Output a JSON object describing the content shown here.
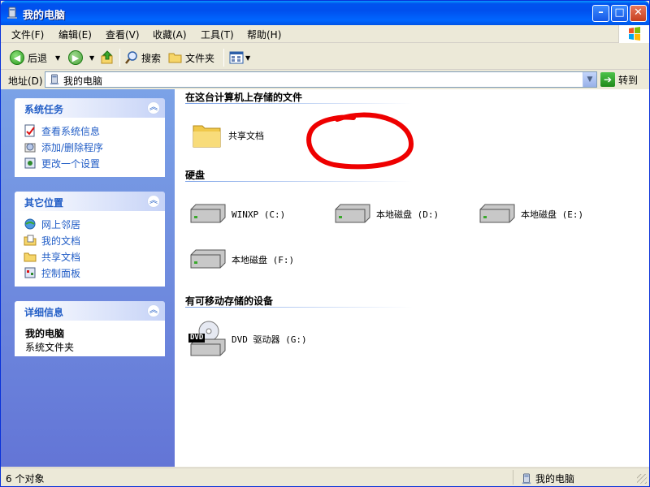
{
  "window": {
    "title": "我的电脑"
  },
  "menu": [
    "文件(F)",
    "编辑(E)",
    "查看(V)",
    "收藏(A)",
    "工具(T)",
    "帮助(H)"
  ],
  "toolbar": {
    "back": "后退",
    "search": "搜索",
    "folders": "文件夹"
  },
  "address": {
    "label": "地址(D)",
    "value": "我的电脑",
    "go": "转到"
  },
  "left_panels": [
    {
      "title": "系统任务",
      "items": [
        "查看系统信息",
        "添加/删除程序",
        "更改一个设置"
      ]
    },
    {
      "title": "其它位置",
      "items": [
        "网上邻居",
        "我的文档",
        "共享文档",
        "控制面板"
      ]
    },
    {
      "title": "详细信息",
      "detail_name": "我的电脑",
      "detail_desc": "系统文件夹"
    }
  ],
  "groups": [
    {
      "title": "在这台计算机上存储的文件",
      "items": [
        "共享文档"
      ]
    },
    {
      "title": "硬盘",
      "items": [
        "WINXP (C:)",
        "本地磁盘 (D:)",
        "本地磁盘 (E:)",
        "本地磁盘 (F:)"
      ]
    },
    {
      "title": "有可移动存储的设备",
      "items": [
        "DVD 驱动器 (G:)"
      ],
      "dvd_badge": "DVD"
    }
  ],
  "status": {
    "count": "6 个对象",
    "location": "我的电脑"
  },
  "colors": {
    "title_blue": "#0054e3",
    "task_blue": "#215dc6",
    "annotation_red": "#ee0000"
  }
}
